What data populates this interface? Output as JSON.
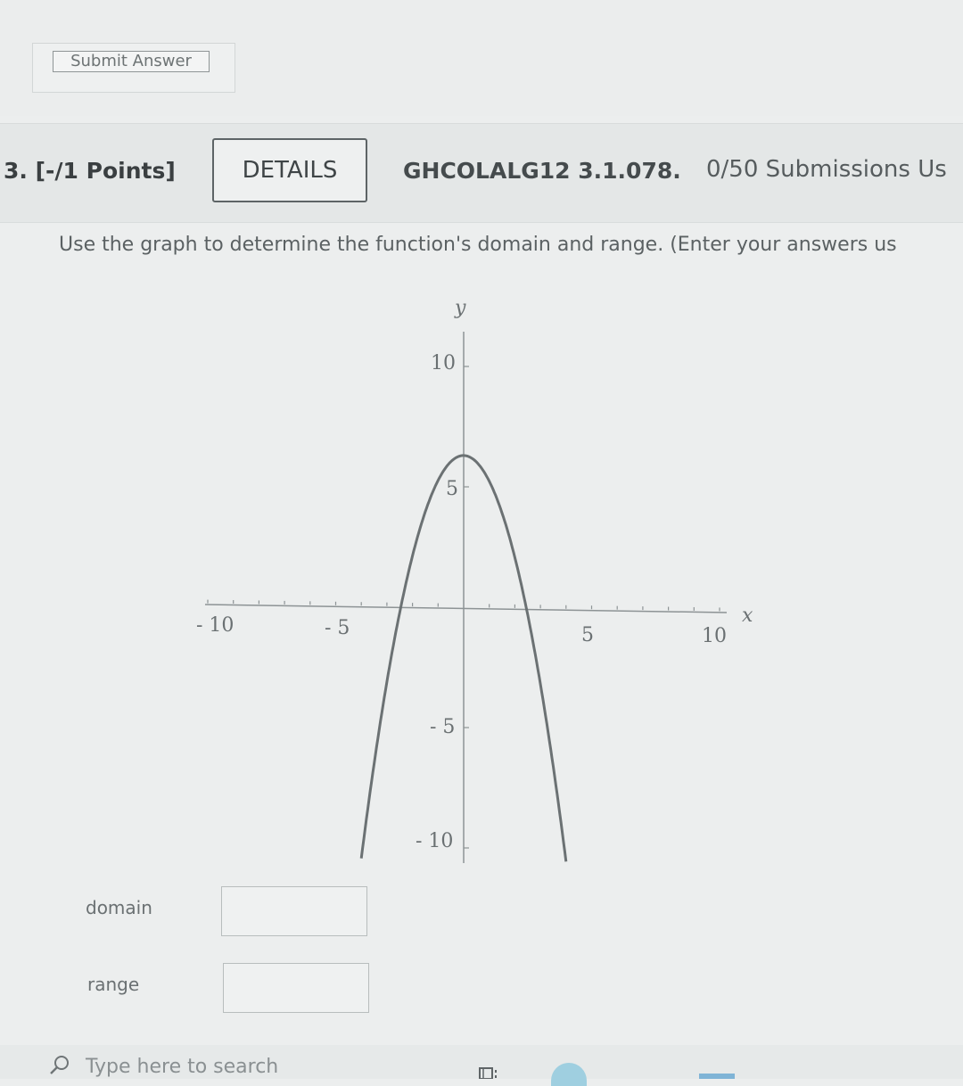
{
  "top": {
    "submit_label": "Submit Answer"
  },
  "question": {
    "number_points": "3. [-/1 Points]",
    "details_label": "DETAILS",
    "code": "GHCOLALG12 3.1.078.",
    "submissions": "0/50 Submissions Us",
    "prompt": "Use the graph to determine the function's domain and range. (Enter your answers us"
  },
  "graph": {
    "x_axis_label": "x",
    "y_axis_label": "y",
    "x_ticks": [
      "- 10",
      "- 5",
      "5",
      "10"
    ],
    "y_ticks": [
      "10",
      "5",
      "- 5",
      "- 10"
    ]
  },
  "chart_data": {
    "type": "line",
    "xlabel": "x",
    "ylabel": "y",
    "xlim": [
      -10,
      10
    ],
    "ylim": [
      -10,
      10
    ],
    "grid": false,
    "series": [
      {
        "x": [
          -4,
          -3,
          -2,
          -1,
          0,
          1,
          2,
          3,
          4
        ],
        "y": [
          -10.5,
          -1.5,
          3.9,
          5.7,
          6.3,
          5.7,
          3.9,
          -1.5,
          -10.5
        ]
      }
    ]
  },
  "form": {
    "domain_label": "domain",
    "domain_value": "",
    "range_label": "range",
    "range_value": ""
  },
  "taskbar": {
    "search_placeholder": "Type here to search"
  },
  "icons": {
    "search": "search-icon",
    "taskview": "task-view-icon",
    "browser": "edge-browser-icon"
  },
  "colors": {
    "curve": "#6b7173",
    "axis": "#8d9395",
    "background": "#eceeee"
  }
}
